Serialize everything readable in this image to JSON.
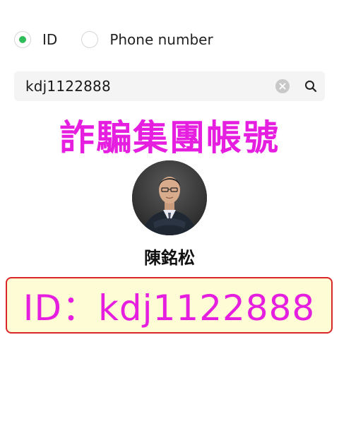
{
  "search_type": {
    "options": [
      {
        "label": "ID",
        "selected": true
      },
      {
        "label": "Phone number",
        "selected": false
      }
    ]
  },
  "search": {
    "value": "kdj1122888",
    "clear_icon": "clear-circle-x",
    "search_icon": "magnifier"
  },
  "overlay": {
    "title": "詐騙集團帳號",
    "id_banner": "ID：kdj1122888"
  },
  "profile": {
    "name": "陳銘松",
    "avatar": "profile-photo"
  },
  "colors": {
    "accent_green": "#2fbd5a",
    "overlay_magenta": "#e51ee0",
    "banner_background": "#fefcd4",
    "banner_border": "#d9262a"
  }
}
